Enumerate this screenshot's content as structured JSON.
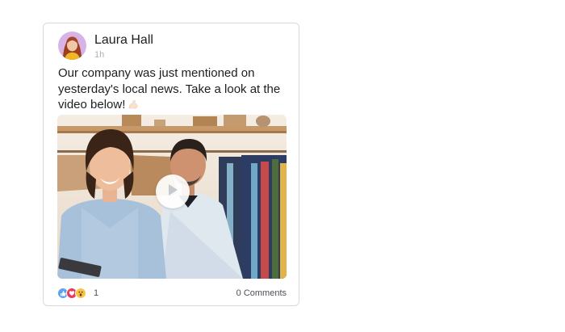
{
  "post": {
    "author": "Laura Hall",
    "time": "1h",
    "text": "Our company was just mentioned on yesterday's local news. Take a look at the video below!",
    "text_emoji": "muscle-arm-emoji"
  },
  "media": {
    "type": "video",
    "play_icon": "play-icon"
  },
  "reactions": {
    "icons": [
      "like-icon",
      "love-icon",
      "wow-icon"
    ],
    "count": "1",
    "comments_label": "0 Comments"
  },
  "colors": {
    "card_border": "#d6d9de",
    "text": "#1c1e21",
    "muted": "#aab0b7",
    "like": "#5aa3f0",
    "love": "#f0365b",
    "wow": "#f7c445"
  }
}
